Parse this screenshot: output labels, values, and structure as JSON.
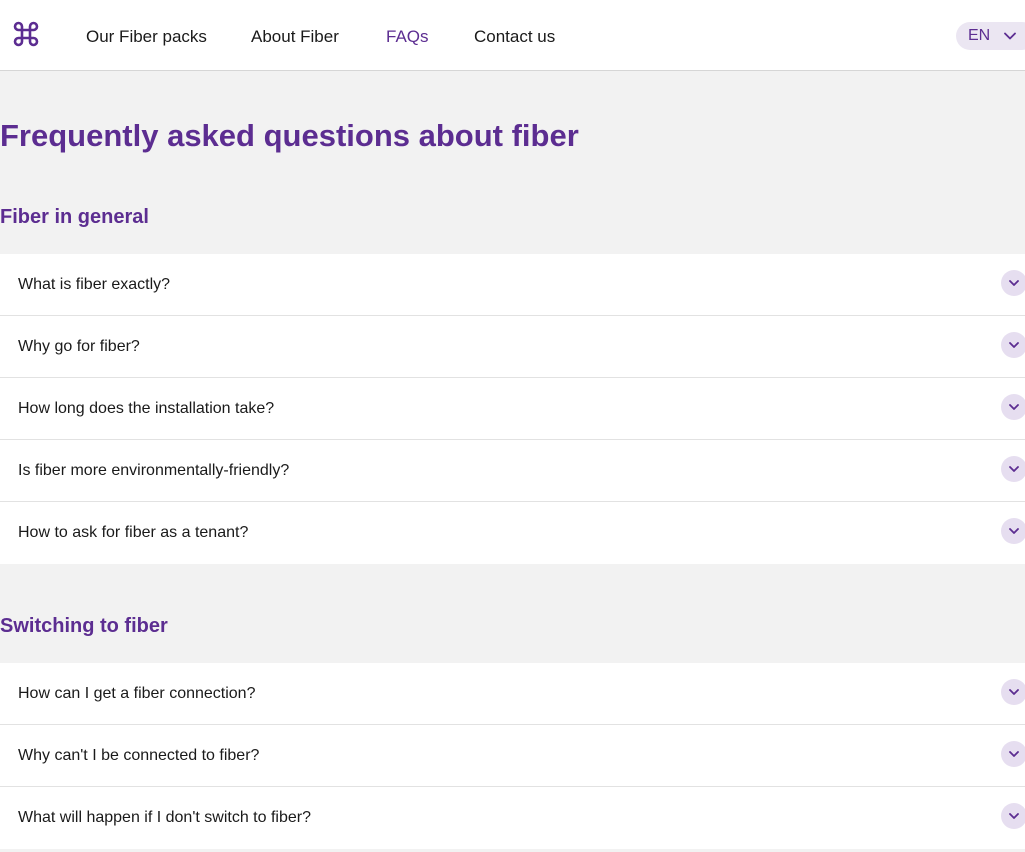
{
  "header": {
    "logo_icon": "command-icon",
    "nav": [
      {
        "label": "Our Fiber packs"
      },
      {
        "label": "About Fiber"
      },
      {
        "label": "FAQs",
        "active": true
      },
      {
        "label": "Contact us"
      }
    ],
    "language": "EN"
  },
  "page": {
    "title": "Frequently asked questions about fiber"
  },
  "sections": [
    {
      "title": "Fiber in general",
      "questions": [
        "What is fiber exactly?",
        "Why go for fiber?",
        "How long does the installation take?",
        "Is fiber more environmentally-friendly?",
        "How to ask for fiber as a tenant?"
      ]
    },
    {
      "title": "Switching to fiber",
      "questions": [
        "How can I get a fiber connection?",
        "Why can't I be connected to fiber?",
        "What will happen if I don't switch to fiber?"
      ]
    }
  ],
  "colors": {
    "brand": "#5c2d91",
    "toggle_bg": "#e6def0",
    "page_bg": "#f2f2f2"
  }
}
